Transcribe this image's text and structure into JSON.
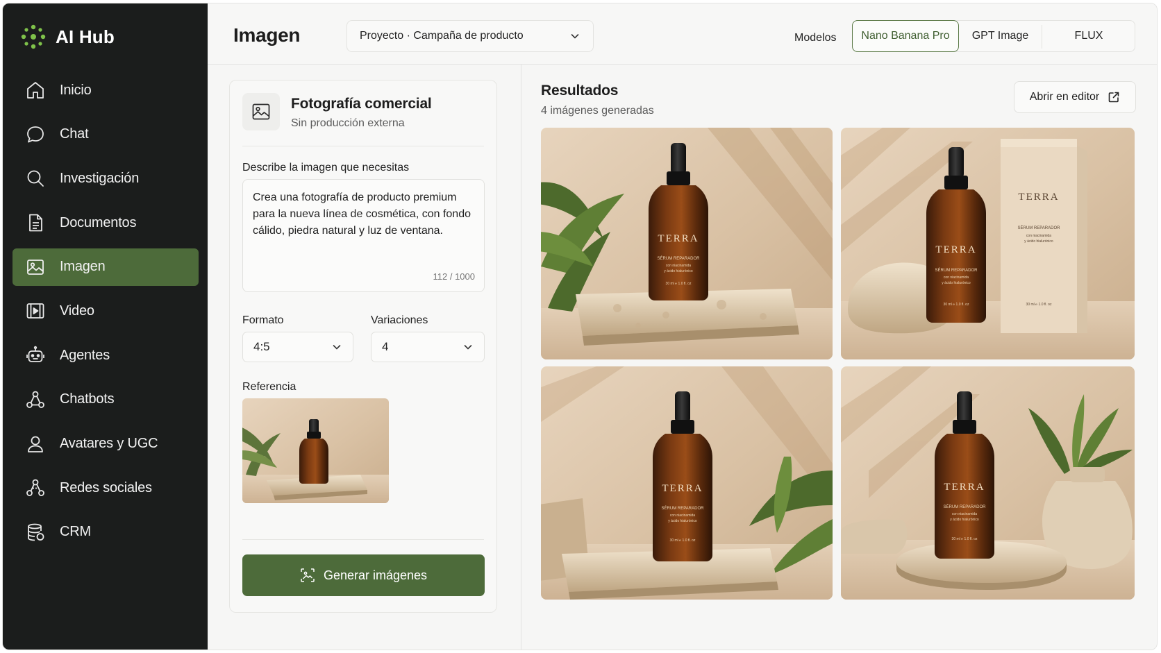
{
  "brand": {
    "name": "AI Hub",
    "logo_icon": "sparkle-dots-logo"
  },
  "sidebar": {
    "items": [
      {
        "label": "Inicio",
        "icon": "home-icon",
        "active": false
      },
      {
        "label": "Chat",
        "icon": "chat-bubble-icon",
        "active": false
      },
      {
        "label": "Investigación",
        "icon": "search-icon",
        "active": false
      },
      {
        "label": "Documentos",
        "icon": "document-icon",
        "active": false
      },
      {
        "label": "Imagen",
        "icon": "image-icon",
        "active": true
      },
      {
        "label": "Video",
        "icon": "video-icon",
        "active": false
      },
      {
        "label": "Agentes",
        "icon": "robot-icon",
        "active": false
      },
      {
        "label": "Chatbots",
        "icon": "network-icon",
        "active": false
      },
      {
        "label": "Avatares y UGC",
        "icon": "user-icon",
        "active": false
      },
      {
        "label": "Redes sociales",
        "icon": "social-network-icon",
        "active": false
      },
      {
        "label": "CRM",
        "icon": "database-icon",
        "active": false
      }
    ]
  },
  "header": {
    "title": "Imagen",
    "project_select": "Proyecto · Campaña de producto",
    "models_label": "Modelos",
    "models": [
      {
        "label": "Nano Banana Pro",
        "active": true
      },
      {
        "label": "GPT Image",
        "active": false
      },
      {
        "label": "FLUX",
        "active": false
      }
    ]
  },
  "form": {
    "preset_title": "Fotografía comercial",
    "preset_subtitle": "Sin producción externa",
    "prompt_label": "Describe la imagen que necesitas",
    "prompt_value": "Crea una fotografía de producto premium para la nueva línea de cosmética, con fondo cálido, piedra natural y luz de ventana.",
    "prompt_count": "112 / 1000",
    "format_label": "Formato",
    "format_value": "4:5",
    "variations_label": "Variaciones",
    "variations_value": "4",
    "reference_label": "Referencia",
    "generate_label": "Generar imágenes"
  },
  "results": {
    "title": "Resultados",
    "subtitle": "4 imágenes generadas",
    "open_editor_label": "Abrir en editor",
    "images": [
      {
        "brand": "TERRA",
        "line1": "SÉRUM REPARADOR",
        "line2": "con niacinamida",
        "line3": "y ácido hialurónico",
        "volume": "30 ml ℮ 1.0 fl. oz"
      },
      {
        "brand": "TERRA",
        "line1": "SÉRUM REPARADOR",
        "line2": "con niacinamida",
        "line3": "y ácido hialurónico",
        "volume": "30 ml ℮ 1.0 fl. oz",
        "box_brand": "TERRA",
        "box_line1": "SÉRUM REPARADOR",
        "box_line2": "con niacinamida",
        "box_line3": "y ácido hialurónico",
        "box_volume": "30 ml ℮ 1.0 fl. oz"
      },
      {
        "brand": "TERRA",
        "line1": "SÉRUM REPARADOR",
        "line2": "con niacinamida",
        "line3": "y ácido hialurónico",
        "volume": "30 ml ℮ 1.0 fl. oz"
      },
      {
        "brand": "TERRA",
        "line1": "SÉRUM REPARADOR",
        "line2": "con niacinamida",
        "line3": "y ácido hialurónico",
        "volume": "30 ml ℮ 1.0 fl. oz"
      }
    ]
  },
  "colors": {
    "accent": "#4d6b3a",
    "sidebar_bg": "#1b1d1c",
    "logo": "#7fc24a"
  }
}
